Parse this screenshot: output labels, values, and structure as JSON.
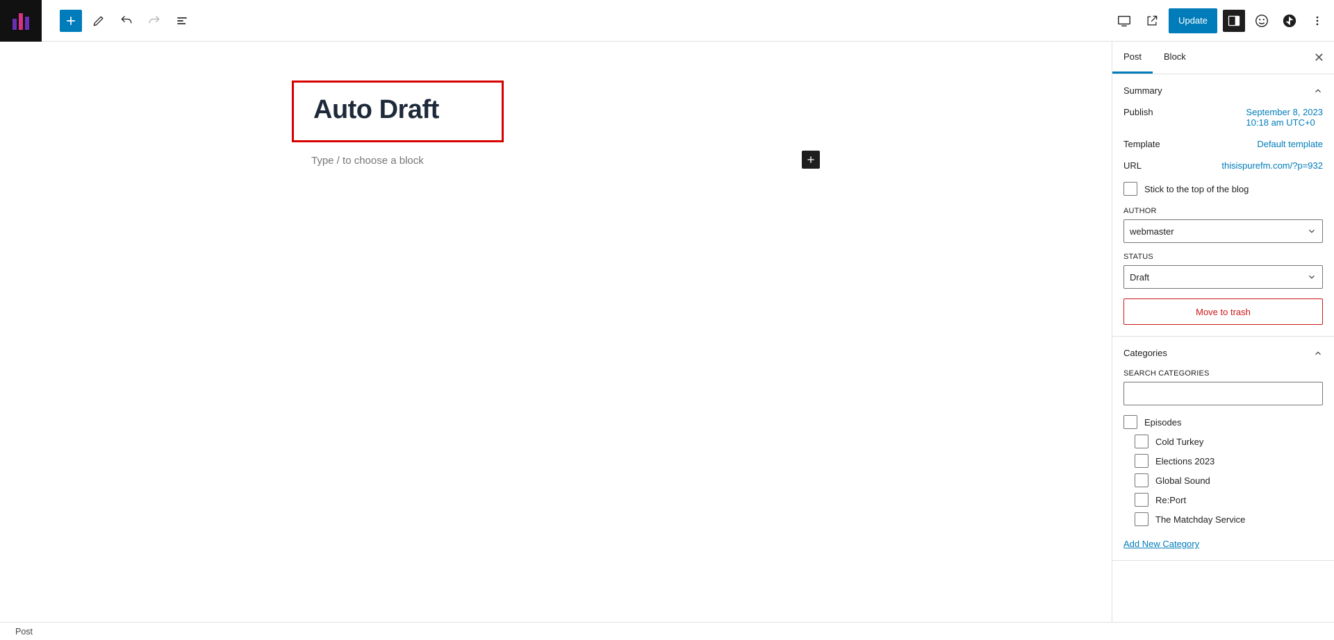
{
  "toolbar": {
    "update_label": "Update"
  },
  "tabs": {
    "post": "Post",
    "block": "Block"
  },
  "editor": {
    "title": "Auto Draft",
    "block_prompt": "Type / to choose a block"
  },
  "summary": {
    "heading": "Summary",
    "publish_label": "Publish",
    "publish_value_line1": "September 8, 2023",
    "publish_value_line2": "10:18 am UTC+0",
    "template_label": "Template",
    "template_value": "Default template",
    "url_label": "URL",
    "url_value": "thisispurefm.com/?p=932",
    "sticky_label": "Stick to the top of the blog",
    "author_label": "AUTHOR",
    "author_value": "webmaster",
    "status_label": "STATUS",
    "status_value": "Draft",
    "trash_label": "Move to trash"
  },
  "categories": {
    "heading": "Categories",
    "search_label": "SEARCH CATEGORIES",
    "items": [
      {
        "label": "Episodes",
        "sub": false
      },
      {
        "label": "Cold Turkey",
        "sub": true
      },
      {
        "label": "Elections 2023",
        "sub": true
      },
      {
        "label": "Global Sound",
        "sub": true
      },
      {
        "label": "Re:Port",
        "sub": true
      },
      {
        "label": "The Matchday Service",
        "sub": true
      }
    ],
    "add_new": "Add New Category"
  },
  "footer": {
    "breadcrumb": "Post"
  }
}
